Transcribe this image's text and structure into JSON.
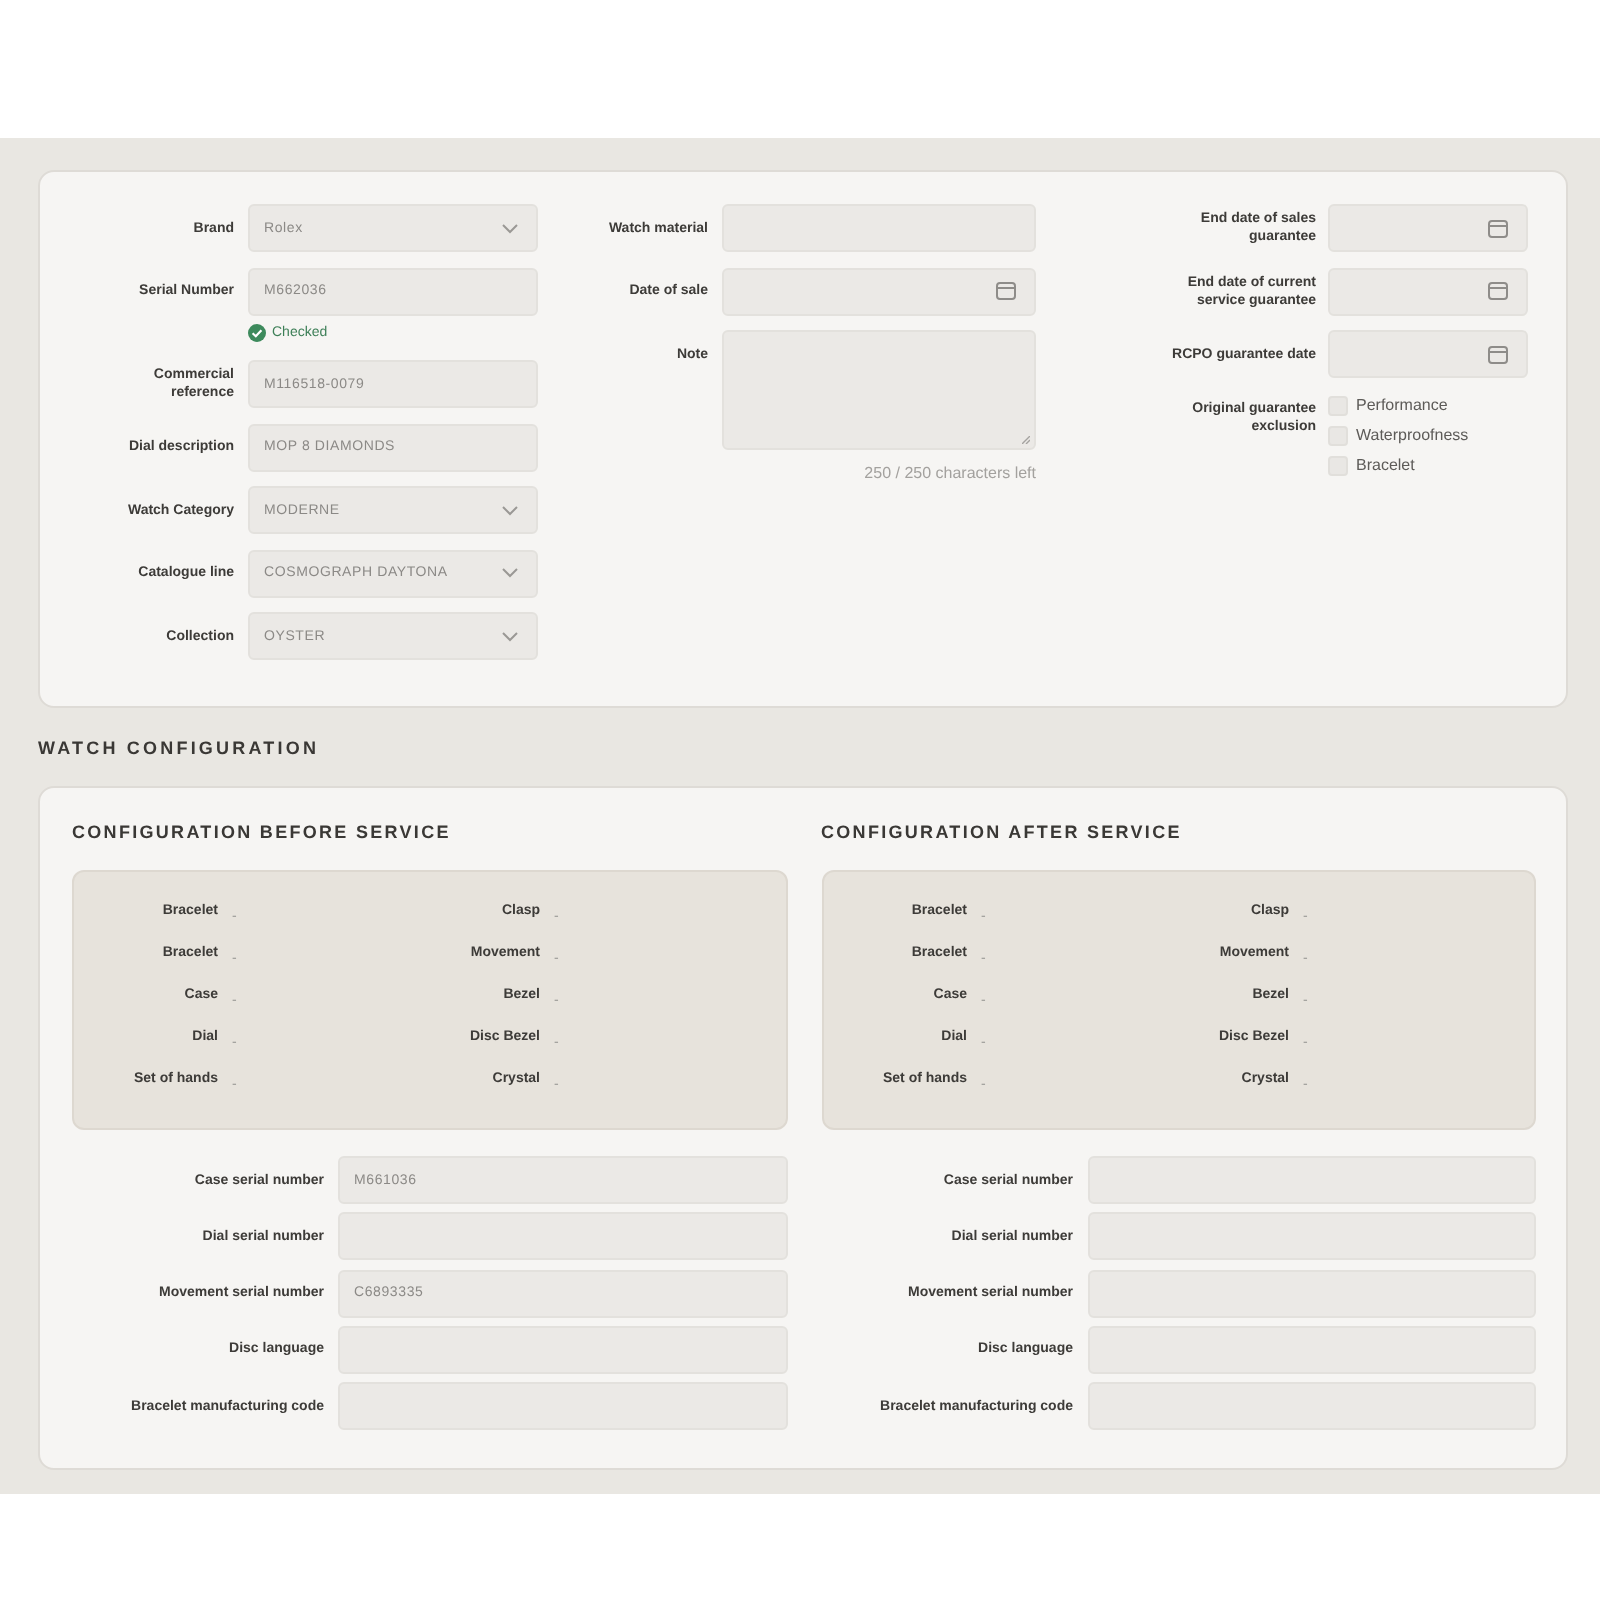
{
  "watch_details": {
    "columns": [
      {
        "fields": [
          {
            "kind": "select",
            "label": "Brand",
            "value": "Rolex"
          },
          {
            "kind": "text",
            "label": "Serial Number",
            "value": "M662036",
            "status": "Checked"
          },
          {
            "kind": "text",
            "label": "Commercial reference",
            "value": "M116518-0079"
          },
          {
            "kind": "text",
            "label": "Dial description",
            "value": "MOP 8 DIAMONDS"
          },
          {
            "kind": "select",
            "label": "Watch Category",
            "value": "MODERNE"
          },
          {
            "kind": "select",
            "label": "Catalogue line",
            "value": "COSMOGRAPH DAYTONA"
          },
          {
            "kind": "select",
            "label": "Collection",
            "value": "OYSTER"
          }
        ]
      },
      {
        "fields": [
          {
            "kind": "text",
            "label": "Watch material"
          },
          {
            "kind": "date",
            "label": "Date of sale"
          },
          {
            "kind": "textarea",
            "label": "Note",
            "counter": "250 / 250 characters left"
          }
        ]
      },
      {
        "fields": [
          {
            "kind": "date",
            "label": "End date of sales guarantee"
          },
          {
            "kind": "date",
            "label": "End date of current service guarantee"
          },
          {
            "kind": "date",
            "label": "RCPO guarantee date"
          },
          {
            "kind": "checkboxes",
            "label": "Original guarantee exclusion",
            "options": [
              {
                "label": "Performance",
                "checked": false
              },
              {
                "label": "Waterproofness",
                "checked": false
              },
              {
                "label": "Bracelet",
                "checked": false
              }
            ]
          }
        ]
      }
    ]
  },
  "section_title": "WATCH CONFIGURATION",
  "configurations": [
    {
      "title": "CONFIGURATION BEFORE SERVICE",
      "parts": [
        {
          "label": "Bracelet",
          "value": "-"
        },
        {
          "label": "Clasp",
          "value": "-"
        },
        {
          "label": "Bracelet",
          "value": "-"
        },
        {
          "label": "Movement",
          "value": "-"
        },
        {
          "label": "Case",
          "value": "-"
        },
        {
          "label": "Bezel",
          "value": "-"
        },
        {
          "label": "Dial",
          "value": "-"
        },
        {
          "label": "Disc Bezel",
          "value": "-"
        },
        {
          "label": "Set of hands",
          "value": "-"
        },
        {
          "label": "Crystal",
          "value": "-"
        }
      ],
      "serials": [
        {
          "label": "Case serial number",
          "value": "M661036"
        },
        {
          "label": "Dial serial number"
        },
        {
          "label": "Movement serial number",
          "value": "C6893335"
        },
        {
          "label": "Disc language"
        },
        {
          "label": "Bracelet manufacturing code"
        }
      ]
    },
    {
      "title": "CONFIGURATION AFTER SERVICE",
      "parts": [
        {
          "label": "Bracelet",
          "value": "-"
        },
        {
          "label": "Clasp",
          "value": "-"
        },
        {
          "label": "Bracelet",
          "value": "-"
        },
        {
          "label": "Movement",
          "value": "-"
        },
        {
          "label": "Case",
          "value": "-"
        },
        {
          "label": "Bezel",
          "value": "-"
        },
        {
          "label": "Dial",
          "value": "-"
        },
        {
          "label": "Disc Bezel",
          "value": "-"
        },
        {
          "label": "Set of hands",
          "value": "-"
        },
        {
          "label": "Crystal",
          "value": "-"
        }
      ],
      "serials": [
        {
          "label": "Case serial number"
        },
        {
          "label": "Dial serial number"
        },
        {
          "label": "Movement serial number"
        },
        {
          "label": "Disc language"
        },
        {
          "label": "Bracelet manufacturing code"
        }
      ]
    }
  ]
}
